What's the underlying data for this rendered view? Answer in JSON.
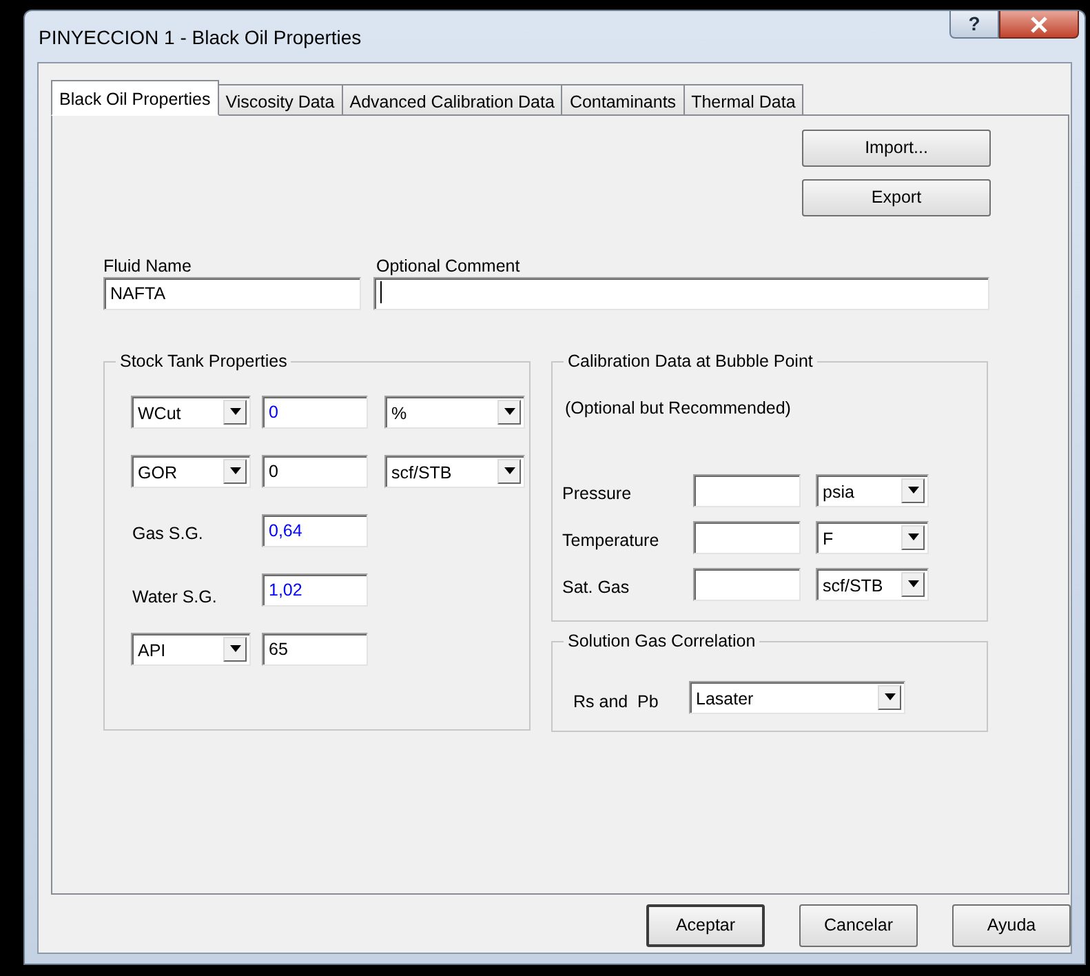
{
  "window": {
    "title": "PINYECCION 1 - Black Oil Properties",
    "help_button": "?"
  },
  "tabs": [
    {
      "label": "Black Oil Properties",
      "selected": true
    },
    {
      "label": "Viscosity Data",
      "selected": false
    },
    {
      "label": "Advanced Calibration Data",
      "selected": false
    },
    {
      "label": "Contaminants",
      "selected": false
    },
    {
      "label": "Thermal Data",
      "selected": false
    }
  ],
  "side_buttons": [
    "Import...",
    "Export"
  ],
  "fluid_name": {
    "label": "Fluid Name",
    "value": "NAFTA"
  },
  "optional_comment": {
    "label": "Optional Comment",
    "focused": true
  },
  "stock_tank": {
    "title": "Stock Tank Properties",
    "rows": [
      {
        "kind": "select",
        "name": "WCut",
        "value": "0",
        "color": "#0000ff",
        "unit": "%"
      },
      {
        "kind": "select",
        "name": "GOR",
        "value": "0",
        "color": "#000000",
        "unit": "scf/STB"
      },
      {
        "kind": "label",
        "name": "Gas S.G.",
        "value": "0,64",
        "color": "#0000ff"
      },
      {
        "kind": "label",
        "name": "Water S.G.",
        "value": "1,02",
        "color": "#0000ff"
      },
      {
        "kind": "select",
        "name": "API",
        "value": "65",
        "color": "#000000"
      }
    ]
  },
  "calibration": {
    "title": "Calibration Data at Bubble Point",
    "note": "(Optional but Recommended)",
    "rows": [
      {
        "label": "Pressure",
        "unit": "psia"
      },
      {
        "label": "Temperature",
        "unit": "F"
      },
      {
        "label": "Sat. Gas",
        "unit": "scf/STB"
      }
    ]
  },
  "solution_gas": {
    "title": "Solution Gas Correlation",
    "label": "Rs and  Pb",
    "value": "Lasater"
  },
  "footer_buttons": [
    {
      "label": "Aceptar",
      "default": true
    },
    {
      "label": "Cancelar",
      "default": false
    },
    {
      "label": "Ayuda",
      "default": false
    }
  ]
}
